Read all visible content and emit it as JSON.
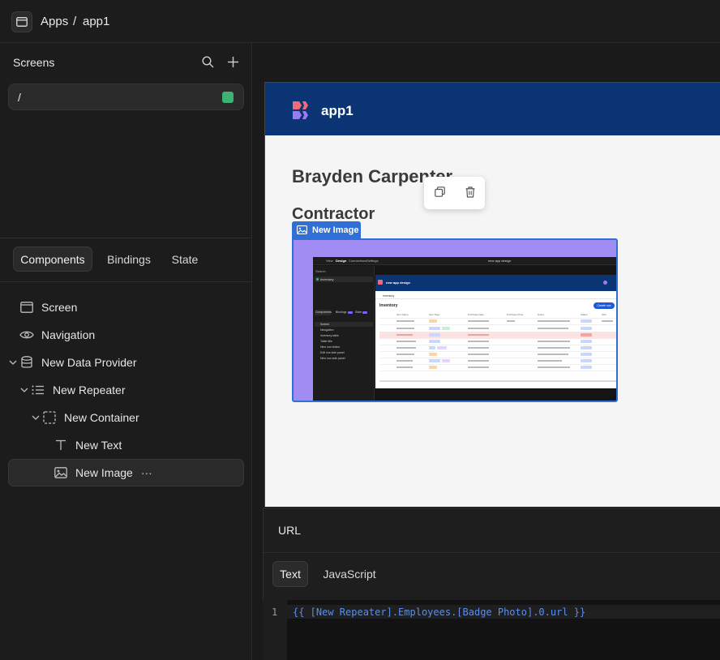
{
  "breadcrumb": {
    "root": "Apps",
    "sep": "/",
    "app": "app1"
  },
  "screens": {
    "title": "Screens",
    "items": [
      {
        "path": "/",
        "status_color": "#3cb371"
      }
    ]
  },
  "panel_tabs": [
    "Components",
    "Bindings",
    "State"
  ],
  "tree": {
    "screen": "Screen",
    "navigation": "Navigation",
    "data_provider": "New Data Provider",
    "repeater": "New Repeater",
    "container": "New Container",
    "text": "New Text",
    "image": "New Image",
    "more": "···"
  },
  "preview": {
    "app_title": "app1",
    "name": "Brayden Carpenter",
    "role": "Contractor",
    "image_label": "New Image",
    "colors": {
      "header": "#0b3474",
      "accent": "#2f6fd6",
      "image_bg": "#a08cf2"
    },
    "mini": {
      "tabs": [
        "View",
        "Design",
        "Connections",
        "Settings"
      ],
      "title": "new app design",
      "search": "Search",
      "sidebar_first": "Inventory",
      "sidebar_tabs": [
        "Components",
        "Bindings",
        "State"
      ],
      "sidebar_items": [
        "Screen",
        "Navigation",
        "Inventory table",
        "Table title",
        "New row button",
        "Edit row side panel",
        "New row side panel"
      ],
      "app_title": "new app design",
      "nav_link": "Inventory",
      "section_title": "Inventory",
      "create_button": "Create row",
      "columns": [
        "Item Name",
        "Item Tags",
        "Purchase Date",
        "Purchase Price",
        "Notes",
        "Status",
        "Size"
      ]
    }
  },
  "editor": {
    "label": "URL",
    "tabs": [
      "Text",
      "JavaScript"
    ],
    "line_number": "1",
    "code": "{{ [New Repeater].Employees.[Badge Photo].0.url }}"
  }
}
